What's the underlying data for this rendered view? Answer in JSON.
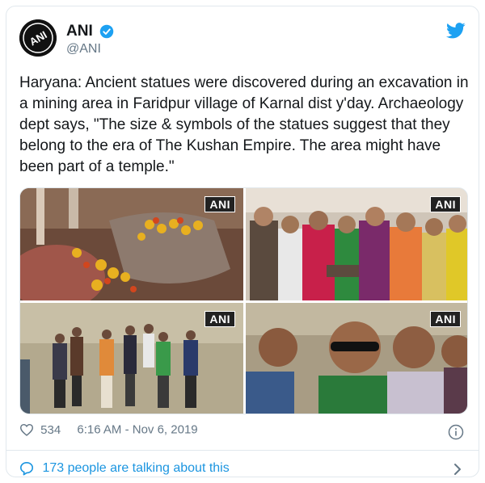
{
  "tweet": {
    "author": {
      "display_name": "ANI",
      "handle": "@ANI",
      "avatar_text": "ANI"
    },
    "text": "Haryana: Ancient statues were discovered during an excavation in a mining area in Faridpur village of Karnal dist y'day. Archaeology dept says, \"The size & symbols of the statues suggest that they belong to the era of The Kushan Empire. The area might have been part of a temple.\"",
    "media": [
      {
        "watermark": "ANI",
        "icon": "ancient-statue-with-flowers"
      },
      {
        "watermark": "ANI",
        "icon": "villagers-crowd"
      },
      {
        "watermark": "ANI",
        "icon": "officials-at-excavation-site"
      },
      {
        "watermark": "ANI",
        "icon": "men-closeup"
      }
    ],
    "likes": "534",
    "timestamp": "6:16 AM - Nov 6, 2019",
    "talking_text": "173 people are talking about this"
  },
  "colors": {
    "link": "#1b95e0",
    "text": "#14171a",
    "muted": "#657786",
    "border": "#e1e8ed"
  }
}
